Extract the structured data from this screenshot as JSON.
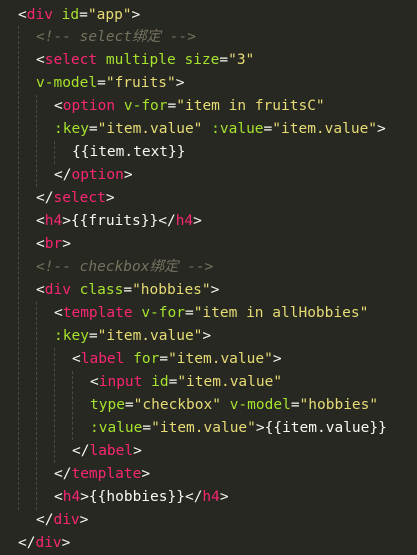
{
  "editor": {
    "lines": [
      [
        {
          "t": "<",
          "c": "p"
        },
        {
          "t": "div",
          "c": "tag"
        },
        {
          "t": " ",
          "c": "p"
        },
        {
          "t": "id",
          "c": "attr"
        },
        {
          "t": "=",
          "c": "p"
        },
        {
          "t": "\"app\"",
          "c": "str"
        },
        {
          "t": ">",
          "c": "p"
        }
      ],
      [
        {
          "t": "<!-- select绑定 -->",
          "c": "cmt"
        }
      ],
      [
        {
          "t": "<",
          "c": "p"
        },
        {
          "t": "select",
          "c": "tag"
        },
        {
          "t": " ",
          "c": "p"
        },
        {
          "t": "multiple",
          "c": "attr"
        },
        {
          "t": " ",
          "c": "p"
        },
        {
          "t": "size",
          "c": "attr"
        },
        {
          "t": "=",
          "c": "p"
        },
        {
          "t": "\"3\"",
          "c": "str"
        }
      ],
      [
        {
          "t": "v-model",
          "c": "attr"
        },
        {
          "t": "=",
          "c": "p"
        },
        {
          "t": "\"fruits\"",
          "c": "str"
        },
        {
          "t": ">",
          "c": "p"
        }
      ],
      [
        {
          "t": "<",
          "c": "p"
        },
        {
          "t": "option",
          "c": "tag"
        },
        {
          "t": " ",
          "c": "p"
        },
        {
          "t": "v-for",
          "c": "attr"
        },
        {
          "t": "=",
          "c": "p"
        },
        {
          "t": "\"item in fruitsC\"",
          "c": "str"
        }
      ],
      [
        {
          "t": ":key",
          "c": "attr"
        },
        {
          "t": "=",
          "c": "p"
        },
        {
          "t": "\"item.value\"",
          "c": "str"
        },
        {
          "t": " ",
          "c": "p"
        },
        {
          "t": ":value",
          "c": "attr"
        },
        {
          "t": "=",
          "c": "p"
        },
        {
          "t": "\"item.value\"",
          "c": "str"
        },
        {
          "t": ">",
          "c": "p"
        }
      ],
      [
        {
          "t": "{{item.text}}",
          "c": "p"
        }
      ],
      [
        {
          "t": "</",
          "c": "p"
        },
        {
          "t": "option",
          "c": "tag"
        },
        {
          "t": ">",
          "c": "p"
        }
      ],
      [
        {
          "t": "</",
          "c": "p"
        },
        {
          "t": "select",
          "c": "tag"
        },
        {
          "t": ">",
          "c": "p"
        }
      ],
      [
        {
          "t": "<",
          "c": "p"
        },
        {
          "t": "h4",
          "c": "tag"
        },
        {
          "t": ">{{fruits}}</",
          "c": "p"
        },
        {
          "t": "h4",
          "c": "tag"
        },
        {
          "t": ">",
          "c": "p"
        }
      ],
      [
        {
          "t": "<",
          "c": "p"
        },
        {
          "t": "br",
          "c": "tag"
        },
        {
          "t": ">",
          "c": "p"
        }
      ],
      [
        {
          "t": "<!-- checkbox绑定 -->",
          "c": "cmt"
        }
      ],
      [
        {
          "t": "<",
          "c": "p"
        },
        {
          "t": "div",
          "c": "tag"
        },
        {
          "t": " ",
          "c": "p"
        },
        {
          "t": "class",
          "c": "attr"
        },
        {
          "t": "=",
          "c": "p"
        },
        {
          "t": "\"hobbies\"",
          "c": "str"
        },
        {
          "t": ">",
          "c": "p"
        }
      ],
      [
        {
          "t": "<",
          "c": "p"
        },
        {
          "t": "template",
          "c": "tag"
        },
        {
          "t": " ",
          "c": "p"
        },
        {
          "t": "v-for",
          "c": "attr"
        },
        {
          "t": "=",
          "c": "p"
        },
        {
          "t": "\"item in allHobbies\"",
          "c": "str"
        }
      ],
      [
        {
          "t": ":key",
          "c": "attr"
        },
        {
          "t": "=",
          "c": "p"
        },
        {
          "t": "\"item.value\"",
          "c": "str"
        },
        {
          "t": ">",
          "c": "p"
        }
      ],
      [
        {
          "t": "<",
          "c": "p"
        },
        {
          "t": "label",
          "c": "tag"
        },
        {
          "t": " ",
          "c": "p"
        },
        {
          "t": "for",
          "c": "attr"
        },
        {
          "t": "=",
          "c": "p"
        },
        {
          "t": "\"item.value\"",
          "c": "str"
        },
        {
          "t": ">",
          "c": "p"
        }
      ],
      [
        {
          "t": "<",
          "c": "p"
        },
        {
          "t": "input",
          "c": "tag"
        },
        {
          "t": " ",
          "c": "p"
        },
        {
          "t": "id",
          "c": "attr"
        },
        {
          "t": "=",
          "c": "p"
        },
        {
          "t": "\"item.value\"",
          "c": "str"
        }
      ],
      [
        {
          "t": "type",
          "c": "attr"
        },
        {
          "t": "=",
          "c": "p"
        },
        {
          "t": "\"checkbox\"",
          "c": "str"
        },
        {
          "t": " ",
          "c": "p"
        },
        {
          "t": "v-model",
          "c": "attr"
        },
        {
          "t": "=",
          "c": "p"
        },
        {
          "t": "\"hobbies\"",
          "c": "str"
        }
      ],
      [
        {
          "t": ":value",
          "c": "attr"
        },
        {
          "t": "=",
          "c": "p"
        },
        {
          "t": "\"item.value\"",
          "c": "str"
        },
        {
          "t": ">{{item.value}}",
          "c": "p"
        }
      ],
      [
        {
          "t": "</",
          "c": "p"
        },
        {
          "t": "label",
          "c": "tag"
        },
        {
          "t": ">",
          "c": "p"
        }
      ],
      [
        {
          "t": "</",
          "c": "p"
        },
        {
          "t": "template",
          "c": "tag"
        },
        {
          "t": ">",
          "c": "p"
        }
      ],
      [
        {
          "t": "<",
          "c": "p"
        },
        {
          "t": "h4",
          "c": "tag"
        },
        {
          "t": ">{{hobbies}}</",
          "c": "p"
        },
        {
          "t": "h4",
          "c": "tag"
        },
        {
          "t": ">",
          "c": "p"
        }
      ],
      [
        {
          "t": "</",
          "c": "p"
        },
        {
          "t": "div",
          "c": "tag"
        },
        {
          "t": ">",
          "c": "p"
        }
      ],
      [
        {
          "t": "</",
          "c": "p"
        },
        {
          "t": "div",
          "c": "tag"
        },
        {
          "t": ">",
          "c": "p"
        }
      ]
    ]
  },
  "colors": {
    "background": "#272822",
    "tag": "#f92672",
    "attribute": "#a6e22e",
    "string": "#e6db74",
    "comment": "#75715e",
    "text": "#f8f8f2"
  }
}
